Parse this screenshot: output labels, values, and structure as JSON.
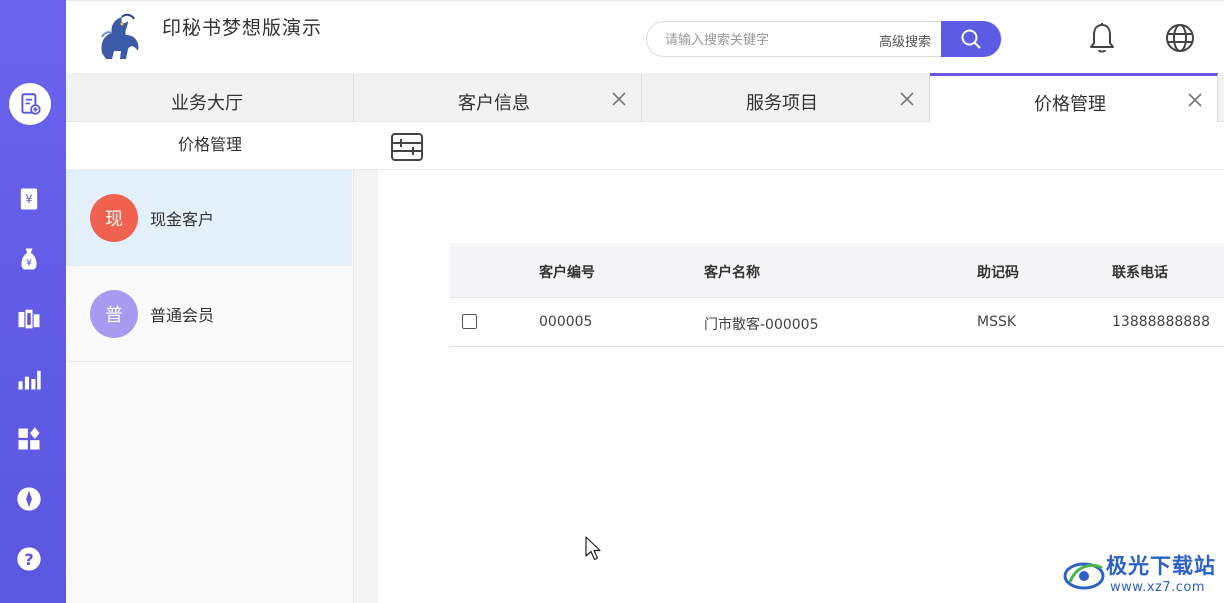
{
  "app": {
    "title": "印秘书梦想版演示"
  },
  "header": {
    "search_placeholder": "请输入搜索关键字",
    "advanced_search_label": "高级搜索"
  },
  "tabs": [
    {
      "label": "业务大厅",
      "closable": false,
      "active": false
    },
    {
      "label": "客户信息",
      "closable": true,
      "active": false
    },
    {
      "label": "服务项目",
      "closable": true,
      "active": false
    },
    {
      "label": "价格管理",
      "closable": true,
      "active": true
    }
  ],
  "rail": {
    "items": [
      "new-order-icon",
      "invoice-icon",
      "money-bag-icon",
      "library-icon",
      "bar-chart-icon",
      "apps-icon",
      "compass-icon",
      "help-icon"
    ]
  },
  "subpanel": {
    "title": "价格管理",
    "customer_types": [
      {
        "avatar": "现",
        "name": "现金客户",
        "color": "#f0624f",
        "selected": true
      },
      {
        "avatar": "普",
        "name": "普通会员",
        "color": "#a79af0",
        "selected": false
      }
    ]
  },
  "table": {
    "columns": [
      "客户编号",
      "客户名称",
      "助记码",
      "联系电话"
    ],
    "rows": [
      [
        "000005",
        "门市散客-000005",
        "MSSK",
        "13888888888"
      ]
    ]
  },
  "watermark": {
    "name": "极光下载站",
    "url": "www.xz7.com"
  },
  "colors": {
    "rail": "#5a57e0",
    "accent": "#5b5be6",
    "active_tab_border": "#6b57e8",
    "selected_row": "#e4effc"
  }
}
